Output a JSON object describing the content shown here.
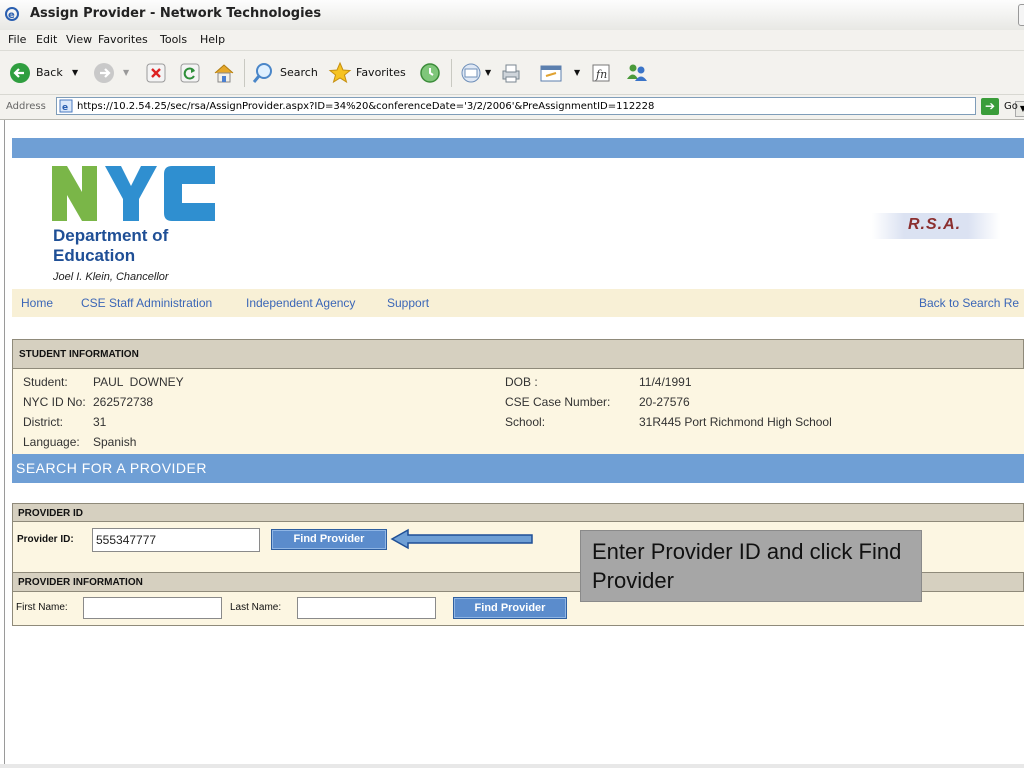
{
  "window": {
    "title": "Assign Provider - Network Technologies"
  },
  "menu": [
    "File",
    "Edit",
    "View",
    "Favorites",
    "Tools",
    "Help"
  ],
  "toolbar": {
    "back": "Back",
    "search": "Search",
    "favorites": "Favorites",
    "icons": [
      "back-arrow-icon",
      "forward-arrow-icon",
      "stop-icon",
      "refresh-icon",
      "home-icon",
      "search-icon",
      "favorites-star-icon",
      "history-icon",
      "mail-icon",
      "print-icon",
      "edit-icon",
      "discuss-icon",
      "messenger-icon"
    ]
  },
  "address": {
    "label": "Address",
    "url": "https://10.2.54.25/sec/rsa/AssignProvider.aspx?ID=34%20&conferenceDate='3/2/2006'&PreAssignmentID=112228",
    "go": "Go"
  },
  "header": {
    "logo_text": "NYC",
    "dept_line1": "Department of",
    "dept_line2": "Education",
    "chancellor": "Joel I. Klein, Chancellor",
    "rsa": "R.S.A.",
    "colors": {
      "green": "#7ab648",
      "blue": "#2f8fd0",
      "dept": "#1f4f96",
      "band": "#6f9fd5"
    }
  },
  "nav": {
    "items": [
      "Home",
      "CSE Staff Administration",
      "Independent Agency",
      "Support"
    ],
    "back": "Back to Search Re"
  },
  "student": {
    "heading": "STUDENT INFORMATION",
    "student_label": "Student:",
    "student_value": "PAUL  DOWNEY",
    "nycid_label": "NYC ID No:",
    "nycid_value": "262572738",
    "district_label": "District:",
    "district_value": "31",
    "language_label": "Language:",
    "language_value": "Spanish",
    "dob_label": "DOB :",
    "dob_value": "11/4/1991",
    "case_label": "CSE Case Number:",
    "case_value": "20-27576",
    "school_label": "School:",
    "school_value": "31R445 Port Richmond High School"
  },
  "search": {
    "heading": "SEARCH FOR A PROVIDER",
    "provider_id_heading": "PROVIDER ID",
    "provider_id_label": "Provider ID:",
    "provider_id_value": "555347777",
    "find_button": "Find Provider",
    "provider_info_heading": "PROVIDER INFORMATION",
    "first_name_label": "First Name:",
    "first_name_value": "",
    "last_name_label": "Last Name:",
    "last_name_value": "",
    "find_button2": "Find Provider"
  },
  "annotation": {
    "text": "Enter Provider ID and click Find Provider"
  }
}
